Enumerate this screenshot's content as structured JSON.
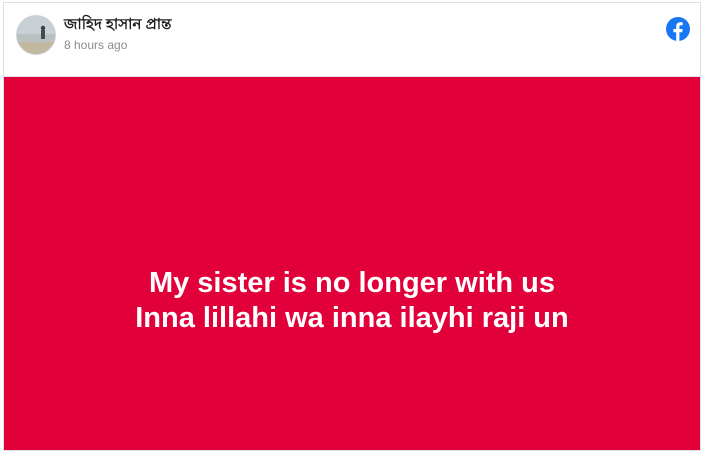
{
  "post": {
    "author_name": "জাহিদ হাসান প্রান্ত",
    "timestamp": "8 hours ago",
    "platform_icon": "facebook-icon",
    "background_color": "#e1003a",
    "text_lines": [
      "My sister is no longer with us",
      "Inna lillahi wa inna ilayhi raji un"
    ]
  },
  "colors": {
    "facebook_blue": "#1877f2",
    "text_white": "#ffffff",
    "timestamp_gray": "#8a8d91"
  }
}
